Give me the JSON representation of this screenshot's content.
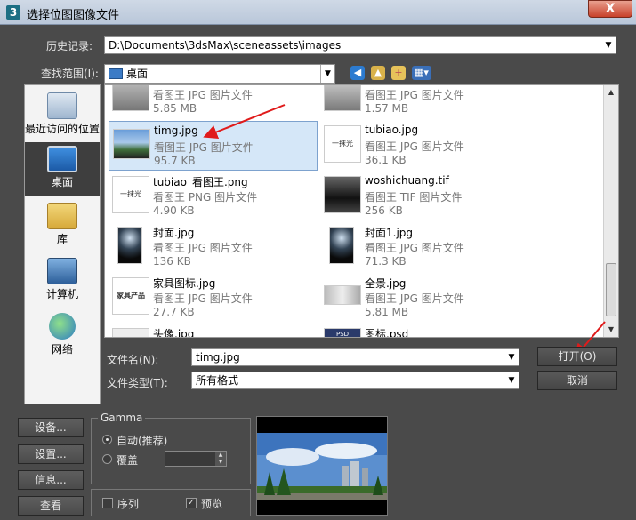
{
  "window": {
    "title": "选择位图图像文件",
    "close_label": "X"
  },
  "history": {
    "label": "历史记录:",
    "value": "D:\\Documents\\3dsMax\\sceneassets\\images"
  },
  "lookin": {
    "label": "查找范围(I):",
    "value": "桌面"
  },
  "places": [
    {
      "label": "最近访问的位置"
    },
    {
      "label": "桌面"
    },
    {
      "label": "库"
    },
    {
      "label": "计算机"
    },
    {
      "label": "网络"
    }
  ],
  "files": [
    {
      "name": "",
      "type": "看图王 JPG 图片文件",
      "size": "5.85 MB"
    },
    {
      "name": "",
      "type": "看图王 JPG 图片文件",
      "size": "1.57 MB"
    },
    {
      "name": "timg.jpg",
      "type": "看图王 JPG 图片文件",
      "size": "95.7 KB"
    },
    {
      "name": "tubiao.jpg",
      "type": "看图王 JPG 图片文件",
      "size": "36.1 KB"
    },
    {
      "name": "tubiao_看图王.png",
      "type": "看图王 PNG 图片文件",
      "size": "4.90 KB"
    },
    {
      "name": "woshichuang.tif",
      "type": "看图王 TIF 图片文件",
      "size": "256 KB"
    },
    {
      "name": "封面.jpg",
      "type": "看图王 JPG 图片文件",
      "size": "136 KB"
    },
    {
      "name": "封面1.jpg",
      "type": "看图王 JPG 图片文件",
      "size": "71.3 KB"
    },
    {
      "name": "家具图标.jpg",
      "type": "看图王 JPG 图片文件",
      "size": "27.7 KB"
    },
    {
      "name": "全景.jpg",
      "type": "看图王 JPG 图片文件",
      "size": "5.81 MB"
    },
    {
      "name": "头像.jpg",
      "type": "",
      "size": ""
    },
    {
      "name": "图标.psd",
      "type": "",
      "size": ""
    }
  ],
  "thumb_text": {
    "tubiao": "一抹光",
    "jiaju": "家具产品",
    "psd": "PSD"
  },
  "filename": {
    "label": "文件名(N):",
    "value": "timg.jpg"
  },
  "filetype": {
    "label": "文件类型(T):",
    "value": "所有格式"
  },
  "buttons": {
    "open": "打开(O)",
    "cancel": "取消",
    "setup": "设备...",
    "settings": "设置...",
    "info": "信息...",
    "view": "查看"
  },
  "gamma": {
    "title": "Gamma",
    "auto": "自动(推荐)",
    "override": "覆盖"
  },
  "options": {
    "sequence": "序列",
    "preview": "预览",
    "preview_checked": true
  }
}
